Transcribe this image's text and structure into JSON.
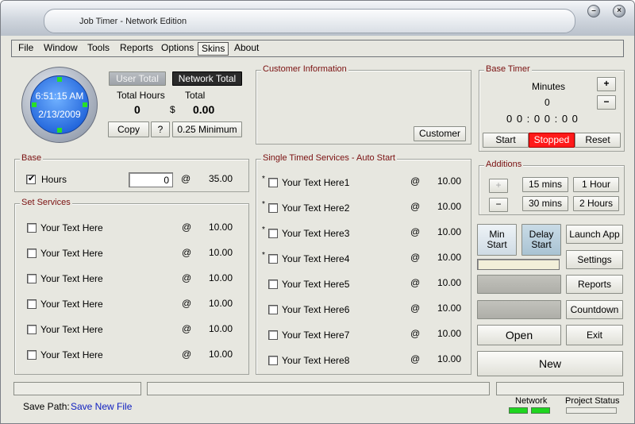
{
  "window": {
    "title": "Job Timer - Network Edition"
  },
  "menu": [
    "File",
    "Window",
    "Tools",
    "Reports",
    "Options",
    "Skins",
    "About"
  ],
  "clock": {
    "time": "6:51:15 AM",
    "date": "2/13/2009"
  },
  "totals": {
    "user_total": "User Total",
    "network_total": "Network Total",
    "hours_label": "Total Hours",
    "total_label": "Total",
    "hours_value": "0",
    "currency": "$",
    "total_value": "0.00",
    "copy": "Copy",
    "help": "?",
    "minimum": "0.25 Minimum"
  },
  "customer": {
    "title": "Customer Information",
    "button": "Customer"
  },
  "base_timer": {
    "title": "Base Timer",
    "minutes_label": "Minutes",
    "minutes_value": "0",
    "plus": "+",
    "minus": "−",
    "display": "0 0 : 0 0 : 0 0",
    "start": "Start",
    "stopped": "Stopped",
    "reset": "Reset"
  },
  "base": {
    "title": "Base",
    "label": "Hours",
    "value": "0",
    "at": "@",
    "rate": "35.00"
  },
  "set_services": {
    "title": "Set Services",
    "items": [
      {
        "label": "Your Text Here",
        "at": "@",
        "rate": "10.00"
      },
      {
        "label": "Your Text Here",
        "at": "@",
        "rate": "10.00"
      },
      {
        "label": "Your Text Here",
        "at": "@",
        "rate": "10.00"
      },
      {
        "label": "Your Text Here",
        "at": "@",
        "rate": "10.00"
      },
      {
        "label": "Your Text Here",
        "at": "@",
        "rate": "10.00"
      },
      {
        "label": "Your Text Here",
        "at": "@",
        "rate": "10.00"
      }
    ]
  },
  "timed_services": {
    "title": "Single Timed Services - Auto Start",
    "items": [
      {
        "label": "Your Text Here1",
        "at": "@",
        "rate": "10.00",
        "star": "*"
      },
      {
        "label": "Your Text Here2",
        "at": "@",
        "rate": "10.00",
        "star": "*"
      },
      {
        "label": "Your Text Here3",
        "at": "@",
        "rate": "10.00",
        "star": "*"
      },
      {
        "label": "Your Text Here4",
        "at": "@",
        "rate": "10.00",
        "star": "*"
      },
      {
        "label": "Your Text Here5",
        "at": "@",
        "rate": "10.00",
        "star": ""
      },
      {
        "label": "Your Text Here6",
        "at": "@",
        "rate": "10.00",
        "star": ""
      },
      {
        "label": "Your Text Here7",
        "at": "@",
        "rate": "10.00",
        "star": ""
      },
      {
        "label": "Your Text Here8",
        "at": "@",
        "rate": "10.00",
        "star": ""
      }
    ]
  },
  "additions": {
    "title": "Additions",
    "plus": "+",
    "minus": "−",
    "b15": "15 mins",
    "b1h": "1 Hour",
    "b30": "30 mins",
    "b2h": "2 Hours"
  },
  "actions": {
    "min_start": "Min\nStart",
    "delay_start": "Delay\nStart",
    "launch_app": "Launch App",
    "settings": "Settings",
    "reports": "Reports",
    "countdown": "Countdown",
    "open": "Open",
    "exit": "Exit",
    "new": "New"
  },
  "footer": {
    "save_path_label": "Save Path:",
    "save_path_value": "Save New File",
    "network": "Network",
    "project_status": "Project Status"
  },
  "colors": {
    "stopped": "#ff1a1a",
    "link": "#1020c0",
    "label": "#7a1010",
    "led": "#1fd61f"
  }
}
